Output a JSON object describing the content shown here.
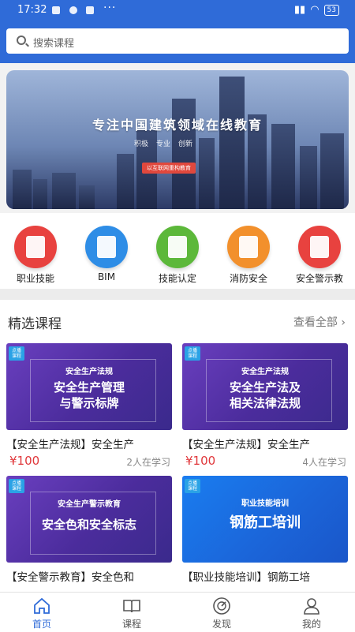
{
  "status_bar": {
    "time": "17:32",
    "dots": "···",
    "battery": "53"
  },
  "search": {
    "placeholder": "搜索课程"
  },
  "banner": {
    "title": "专注中国建筑领域在线教育",
    "tags": [
      "积极",
      "专业",
      "创新"
    ],
    "button": "以互联网重构教育"
  },
  "categories": [
    {
      "label": "职业技能",
      "icon": "folder-icon",
      "color": "#e8423f"
    },
    {
      "label": "BIM",
      "icon": "document-icon",
      "color": "#2e8de6"
    },
    {
      "label": "技能认定",
      "icon": "tools-icon",
      "color": "#5cb83a"
    },
    {
      "label": "消防安全",
      "icon": "edit-icon",
      "color": "#f2902c"
    },
    {
      "label": "安全警示教",
      "icon": "folder-icon",
      "color": "#e8423f"
    }
  ],
  "section": {
    "title": "精选课程",
    "more": "查看全部"
  },
  "courses": [
    {
      "tag": "点播课程",
      "subtitle": "安全生产法规",
      "headline": "安全生产管理\n与警示标牌",
      "title": "【安全生产法规】安全生产",
      "price": "¥100",
      "learners": "2人在学习",
      "style": "purple"
    },
    {
      "tag": "点播课程",
      "subtitle": "安全生产法规",
      "headline": "安全生产法及\n相关法律法规",
      "title": "【安全生产法规】安全生产",
      "price": "¥100",
      "learners": "4人在学习",
      "style": "purple"
    },
    {
      "tag": "点播课程",
      "subtitle": "安全生产警示教育",
      "headline": "安全色和安全标志",
      "title": "【安全警示教育】安全色和",
      "price": "",
      "learners": "",
      "style": "purple"
    },
    {
      "tag": "点播课程",
      "subtitle": "职业技能培训",
      "headline": "钢筋工培训",
      "title": "【职业技能培训】钢筋工培",
      "price": "",
      "learners": "",
      "style": "blue"
    }
  ],
  "tabbar": [
    {
      "label": "首页",
      "icon": "home-icon",
      "active": true
    },
    {
      "label": "课程",
      "icon": "book-icon",
      "active": false
    },
    {
      "label": "发现",
      "icon": "compass-icon",
      "active": false
    },
    {
      "label": "我的",
      "icon": "user-icon",
      "active": false
    }
  ],
  "colors": {
    "primary": "#2f6bd8",
    "price": "#e0373b"
  }
}
